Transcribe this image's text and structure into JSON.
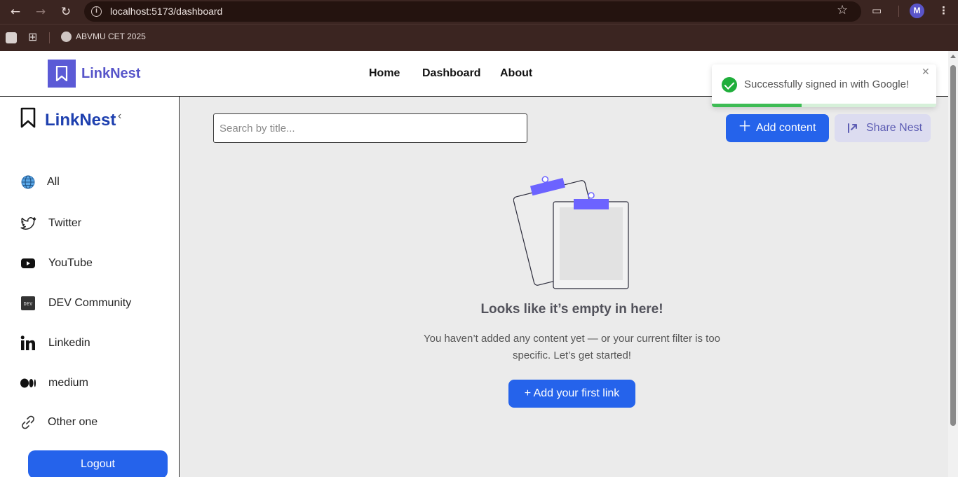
{
  "browser": {
    "url": "localhost:5173/dashboard",
    "bookmark_label": "ABVMU CET 2025",
    "profile_initial": "M"
  },
  "topnav": {
    "brand": "LinkNest",
    "links": [
      "Home",
      "Dashboard",
      "About"
    ]
  },
  "sidebar": {
    "brand": "LinkNest",
    "items": [
      {
        "label": "All",
        "icon": "globe-icon"
      },
      {
        "label": "Twitter",
        "icon": "twitter-icon"
      },
      {
        "label": "YouTube",
        "icon": "youtube-icon"
      },
      {
        "label": "DEV Community",
        "icon": "dev-icon"
      },
      {
        "label": "Linkedin",
        "icon": "linkedin-icon"
      },
      {
        "label": "medium",
        "icon": "medium-icon"
      },
      {
        "label": "Other one",
        "icon": "link-icon"
      }
    ],
    "logout_label": "Logout"
  },
  "main": {
    "search_placeholder": "Search by title...",
    "add_content_label": "Add content",
    "share_label": "Share Nest",
    "empty_title": "Looks like it’s empty in here!",
    "empty_desc": "You haven’t added any content yet — or your current filter is too specific. Let’s get started!",
    "first_link_label": "+ Add your first link"
  },
  "toast": {
    "message": "Successfully signed in with Google!",
    "progress": 0.4,
    "close_glyph": "✕"
  },
  "colors": {
    "primary": "#2563eb",
    "brand": "#5b5ad6",
    "success": "#1fae3b"
  }
}
